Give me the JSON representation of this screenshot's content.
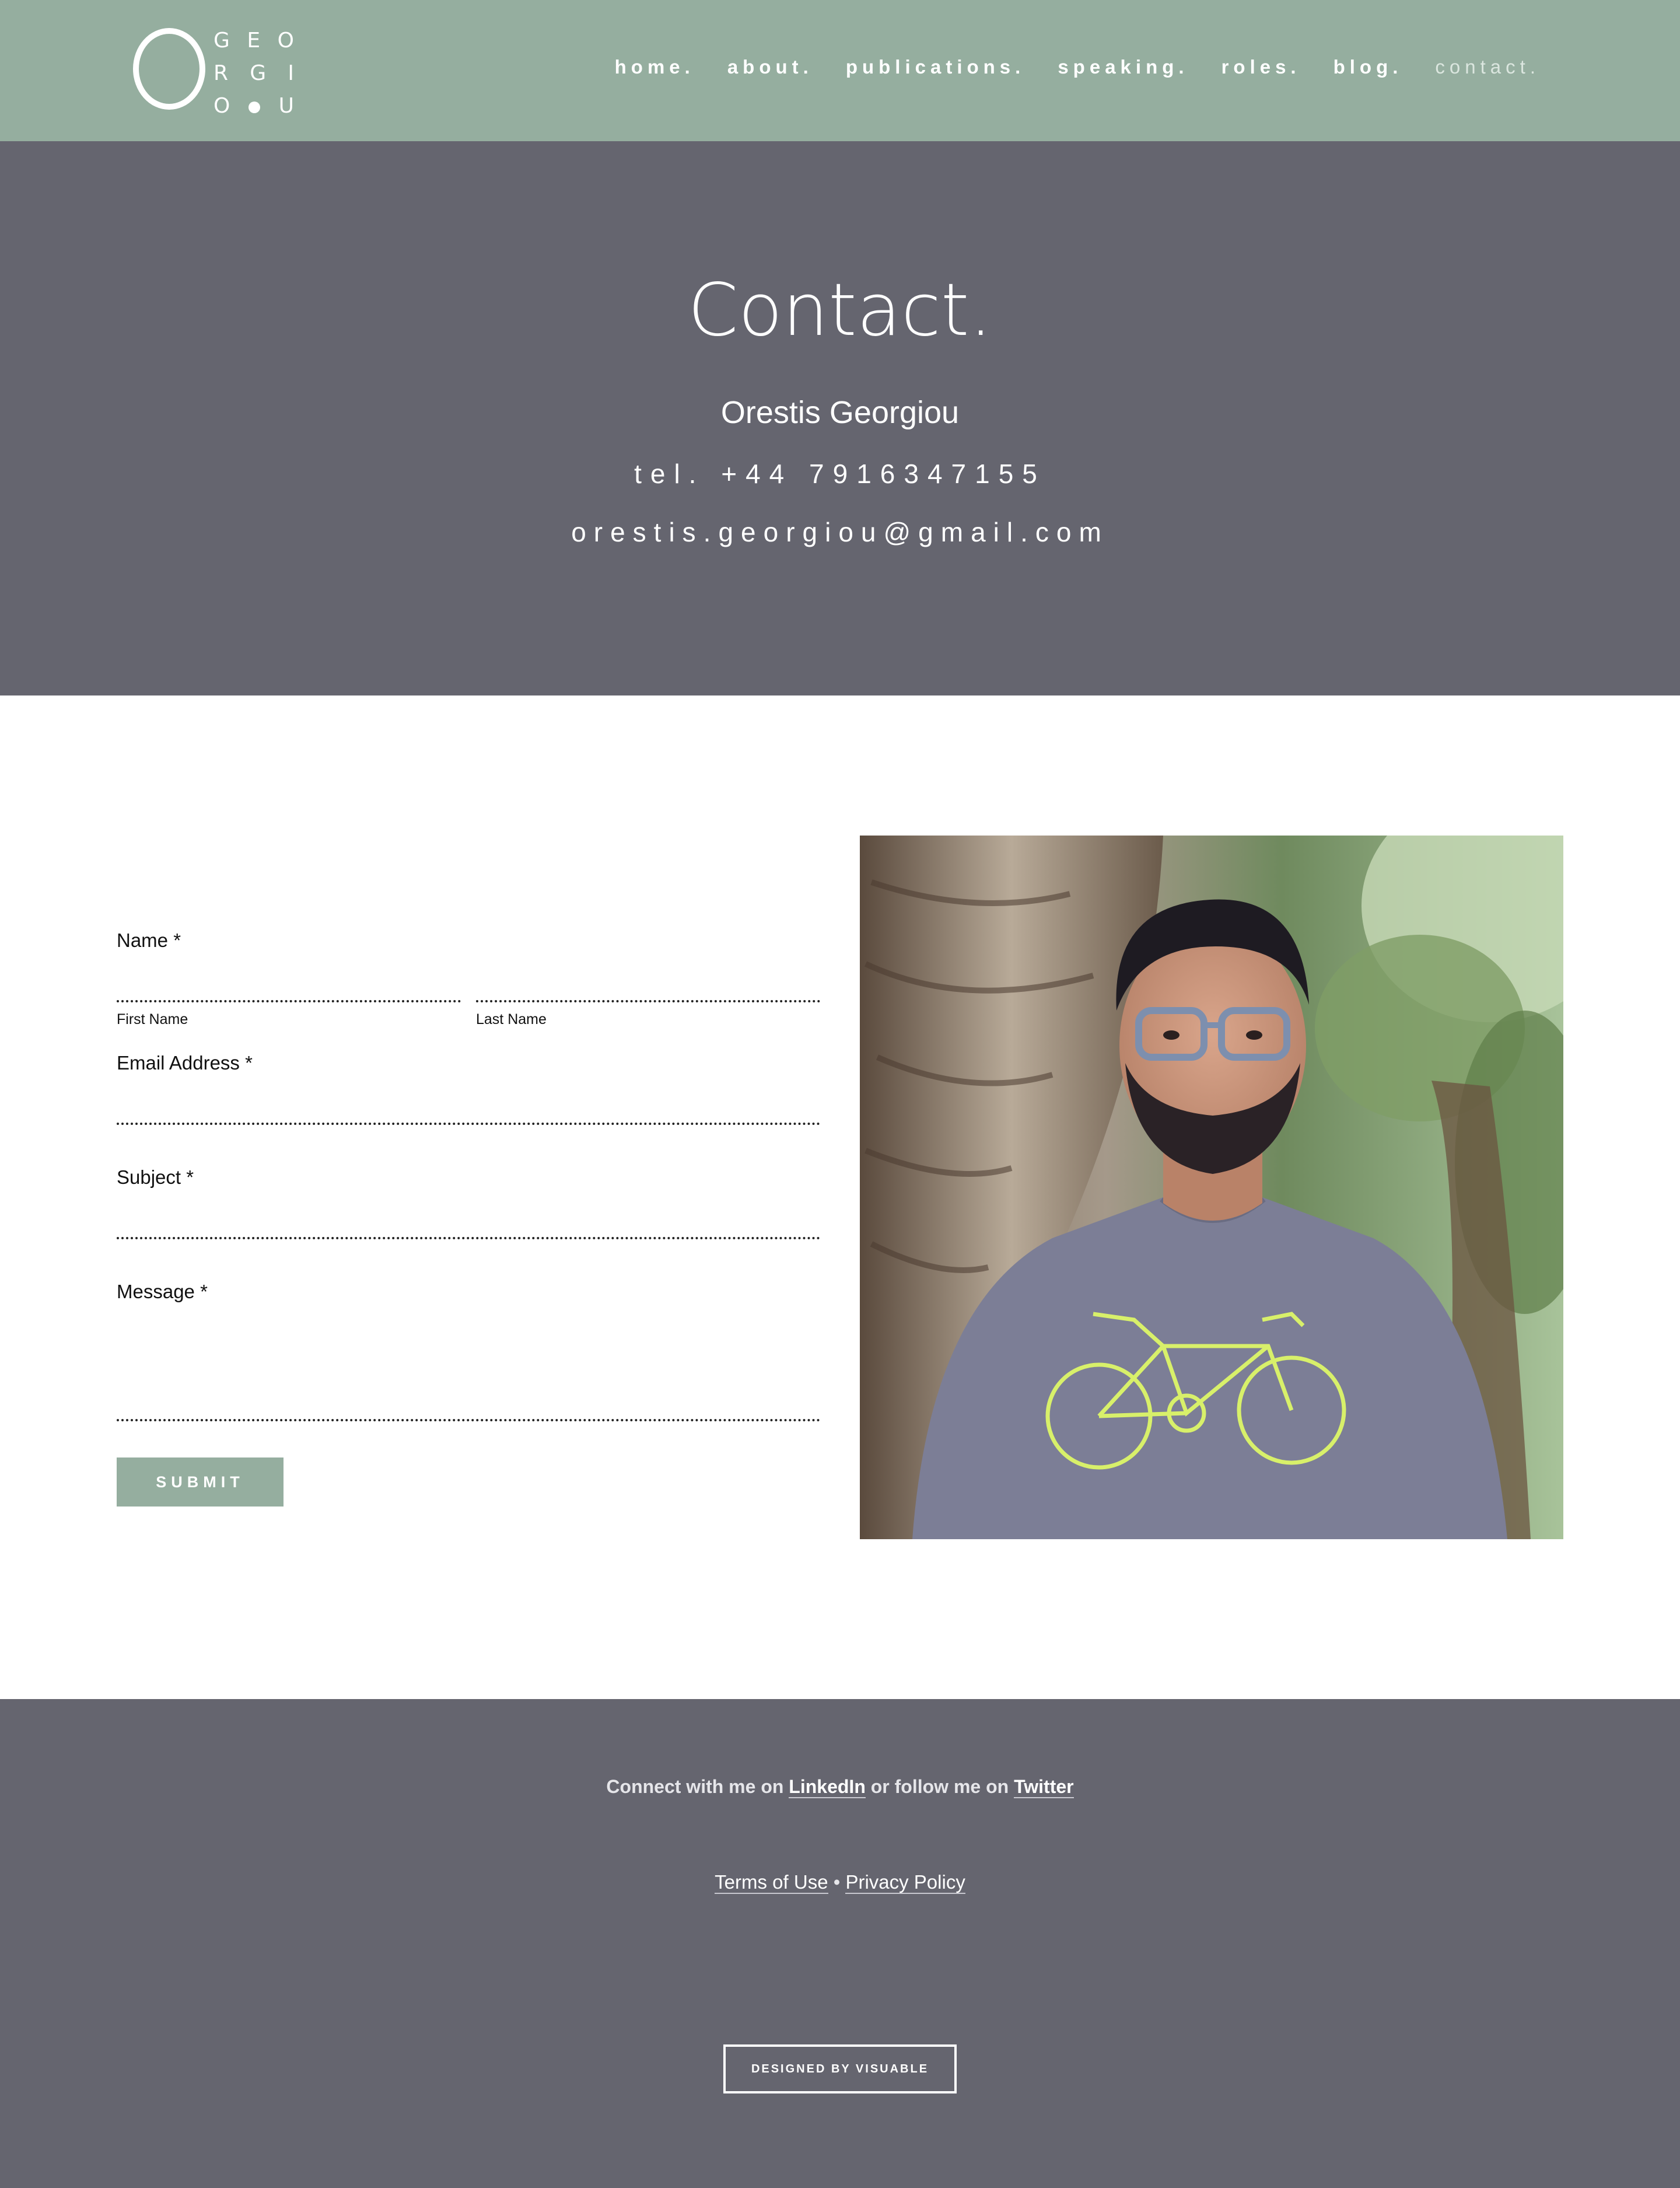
{
  "colors": {
    "header_bg": "#95ae9f",
    "hero_bg": "#65656f",
    "footer_bg": "#65656f",
    "accent": "#95ae9f",
    "text_dark": "#111111"
  },
  "logo": {
    "big_letter": "O",
    "rows": [
      [
        "G",
        "E",
        "O"
      ],
      [
        "R",
        "G",
        "I"
      ],
      [
        "O",
        "dot",
        "U"
      ]
    ]
  },
  "nav": {
    "items": [
      {
        "label": "home."
      },
      {
        "label": "about."
      },
      {
        "label": "publications."
      },
      {
        "label": "speaking."
      },
      {
        "label": "roles."
      },
      {
        "label": "blog."
      },
      {
        "label": "contact.",
        "active": true
      }
    ]
  },
  "hero": {
    "title": "Contact.",
    "name": "Orestis Georgiou",
    "phone": "tel. +44 7916347155",
    "email": "orestis.georgiou@gmail.com"
  },
  "form": {
    "name_label": "Name *",
    "first_name_label": "First Name",
    "last_name_label": "Last Name",
    "first_name_value": "",
    "last_name_value": "",
    "email_label": "Email Address *",
    "email_value": "",
    "subject_label": "Subject *",
    "subject_value": "",
    "message_label": "Message *",
    "message_value": "",
    "submit_label": "SUBMIT"
  },
  "photo": {
    "subject": "portrait of a man with glasses in a grey bicycle t-shirt in front of palm trees",
    "icon": "portrait-photo"
  },
  "footer": {
    "social_prefix": "Connect with me on ",
    "linkedin": "LinkedIn",
    "social_middle": " or follow me on ",
    "twitter": "Twitter",
    "terms": "Terms of Use",
    "separator": " • ",
    "privacy": "Privacy Policy",
    "designed_by": "DESIGNED BY VISUABLE"
  }
}
